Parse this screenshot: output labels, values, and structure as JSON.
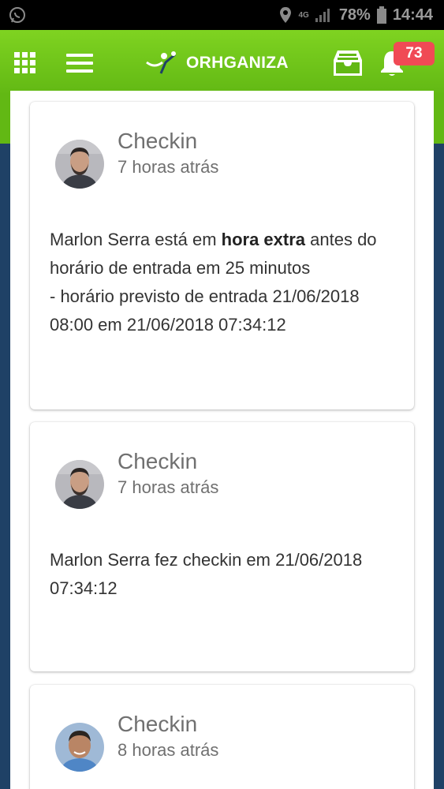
{
  "status_bar": {
    "battery": "78%",
    "time": "14:44",
    "network": "4G"
  },
  "header": {
    "logo_text": "ORHGANIZA",
    "notification_count": "73",
    "colors": {
      "header_green": "#62b814",
      "badge_red": "#f04a55",
      "background_navy": "#1f4166"
    },
    "icons": [
      "grid-icon",
      "hamburger-menu-icon",
      "inbox-icon",
      "bell-icon"
    ]
  },
  "cards": [
    {
      "title": "Checkin",
      "time": "7 horas atrás",
      "body_pre": "Marlon Serra está em ",
      "body_bold": "hora extra",
      "body_post": " antes do horário de entrada em 25 minutos",
      "body_line2": "- horário previsto de entrada 21/06/2018 08:00 em 21/06/2018 07:34:12"
    },
    {
      "title": "Checkin",
      "time": "7 horas atrás",
      "body": "Marlon Serra fez checkin em 21/06/2018 07:34:12"
    },
    {
      "title": "Checkin",
      "time": "8 horas atrás"
    }
  ]
}
